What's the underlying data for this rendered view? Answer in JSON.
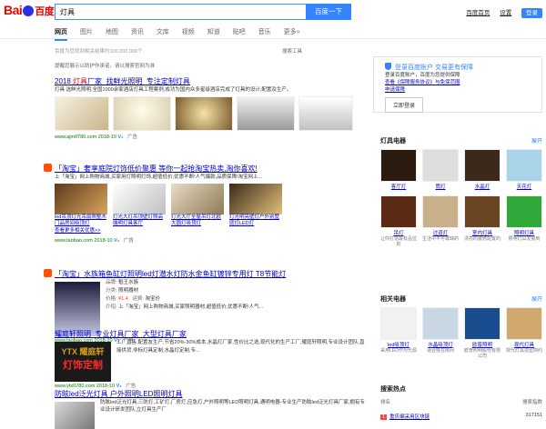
{
  "header": {
    "logo_text": "Bai",
    "logo_cn": "百度",
    "query": "灯具",
    "search_button": "百度一下",
    "links": [
      "百度首页",
      "设置",
      "登录"
    ]
  },
  "tabs": [
    "网页",
    "图片",
    "地图",
    "资讯",
    "文库",
    "视频",
    "知道",
    "贴吧",
    "音乐",
    "更多»"
  ],
  "stats": "百度为您找到相关结果约100,000,000个",
  "search_tools": "搜索工具",
  "tip": "提醒您展示以防护作承诺，请以搜索官网为准",
  "results": [
    {
      "title_pre": "2018 ",
      "title_em": "灯具",
      "title_post": "厂家_找鲜光照明_专注定制灯具",
      "abstract": "灯具 选鲜光照明,全国1000余家酒店灯具工程案例,成功为国内众多星级酒店完成了灯具的设计,配置及生产。",
      "url": "www.ajm0780.com",
      "date": "2018-10",
      "ad": "广告"
    },
    {
      "title": "「淘宝」奢享庭院灯饰低价聚惠 等你一起抢淘宝热卖,淘你喜欢!",
      "abstract": "上「淘宝」网上购物商城,买家用灯照明灯饰,超值低价,优惠不断!人气爆款,品质保障!淘宝网上...",
      "captions": [
        "led吊顶灯光吊扇照整木门品房间吸顶灯",
        "灯光大灯吊顶壁灯照高端明灯具客厅",
        "灯光大厅全屋吊灯北欧大圆灯吸顶灯",
        "灯光明亮壁灯户外别墅庭灯LED灯"
      ],
      "more": "查看更多相关优惠>>",
      "url": "www.taobao.com",
      "date": "2018-10",
      "ad": "广告"
    },
    {
      "title": "「淘宝」水族箱鱼缸灯照明led灯潜水灯防水金鱼缸镀锌专用灯 T8节能灯",
      "brand_label": "品牌:",
      "brand": "魁王水族",
      "type_label": "分类:",
      "type": "照明器材",
      "price_label": "价格:",
      "price": "¥1.4",
      "ship_label": "运费:",
      "ship": "淘宝价",
      "intro_label": "介绍:",
      "intro": "上「淘宝」网上购物商城,买家照明器材,超值低价,优惠不断!人气...",
      "url": "www.taobao.com",
      "date": "2018-10",
      "ad": "广告"
    },
    {
      "title": "耀庭轩照明_专业灯具厂家_大型灯具厂家",
      "abstract": "工厂直售,配置友生产,节省20%-30%成本,水晶灯厂家,性价比之选,现代化的生产工厂,耀庭轩照明,专业设计团队,直接供货,非标灯具定制,水晶灯定制,专...",
      "logo_line1": "YTX 耀庭轩",
      "logo_line2": "灯饰定制",
      "url": "www.ytx0780.com",
      "date": "2018-10",
      "ad": "广告"
    },
    {
      "title": "防眩led泛光灯具 户外照明LED照明灯具",
      "abstract": "防眩led泛光灯具,三防灯,工矿灯,厂房灯,应急灯,户外照明等LED照明灯具,通明电器-专业生产防眩led泛光灯具厂家,拥有专业设计研发团队,立灯具生产厂",
      "url": "",
      "date": "",
      "ad": ""
    }
  ],
  "sidebar_login": {
    "title": "登录百度账户 交易更有保障",
    "line1": "登录百度账户，百度为您提供保障",
    "line2": "查看《保障服务协议》与免保范围",
    "line3": "申请保障",
    "button": "立即登录"
  },
  "panel1": {
    "title": "灯具电器",
    "more": "展开",
    "items": [
      {
        "name": "客厅灯",
        "desc": "",
        "color": "#2b1a0e"
      },
      {
        "name": "筒灯",
        "desc": "",
        "color": "#dedede"
      },
      {
        "name": "水晶灯",
        "desc": "",
        "color": "#3b2a1a"
      },
      {
        "name": "天花灯",
        "desc": "",
        "color": "#a7d4e8"
      },
      {
        "name": "吊灯",
        "desc": "让你打造最有品位的",
        "color": "#5b2a14"
      },
      {
        "name": "过道灯",
        "desc": "生活中不可或缺的",
        "color": "#c7b08a"
      },
      {
        "name": "室内灯具",
        "desc": "漂亮的装修配置的",
        "color": "#6b4423"
      },
      {
        "name": "照明灯具",
        "desc": "照明灯具发展到",
        "color": "#2faa3a"
      }
    ]
  },
  "panel2": {
    "title": "相关电器",
    "more": "展开",
    "items": [
      {
        "name": "led吸顶灯",
        "desc": "采用LED作为光源",
        "color": "#f1f1f1"
      },
      {
        "name": "水晶吸顶灯",
        "desc": "适合吸在房间",
        "color": "#c9d6e3"
      },
      {
        "name": "欧普照明",
        "desc": "欧普照明股份有限公司",
        "color": "#1a4d8f"
      },
      {
        "name": "现代灯具",
        "desc": "现代灯具造型简约",
        "color": "#d1a86b"
      }
    ]
  },
  "hot": {
    "title": "搜索热点",
    "col1": "排名",
    "col2": "搜索指数",
    "rank": "1",
    "item": "重庆编采用区块链",
    "value": "317151"
  }
}
